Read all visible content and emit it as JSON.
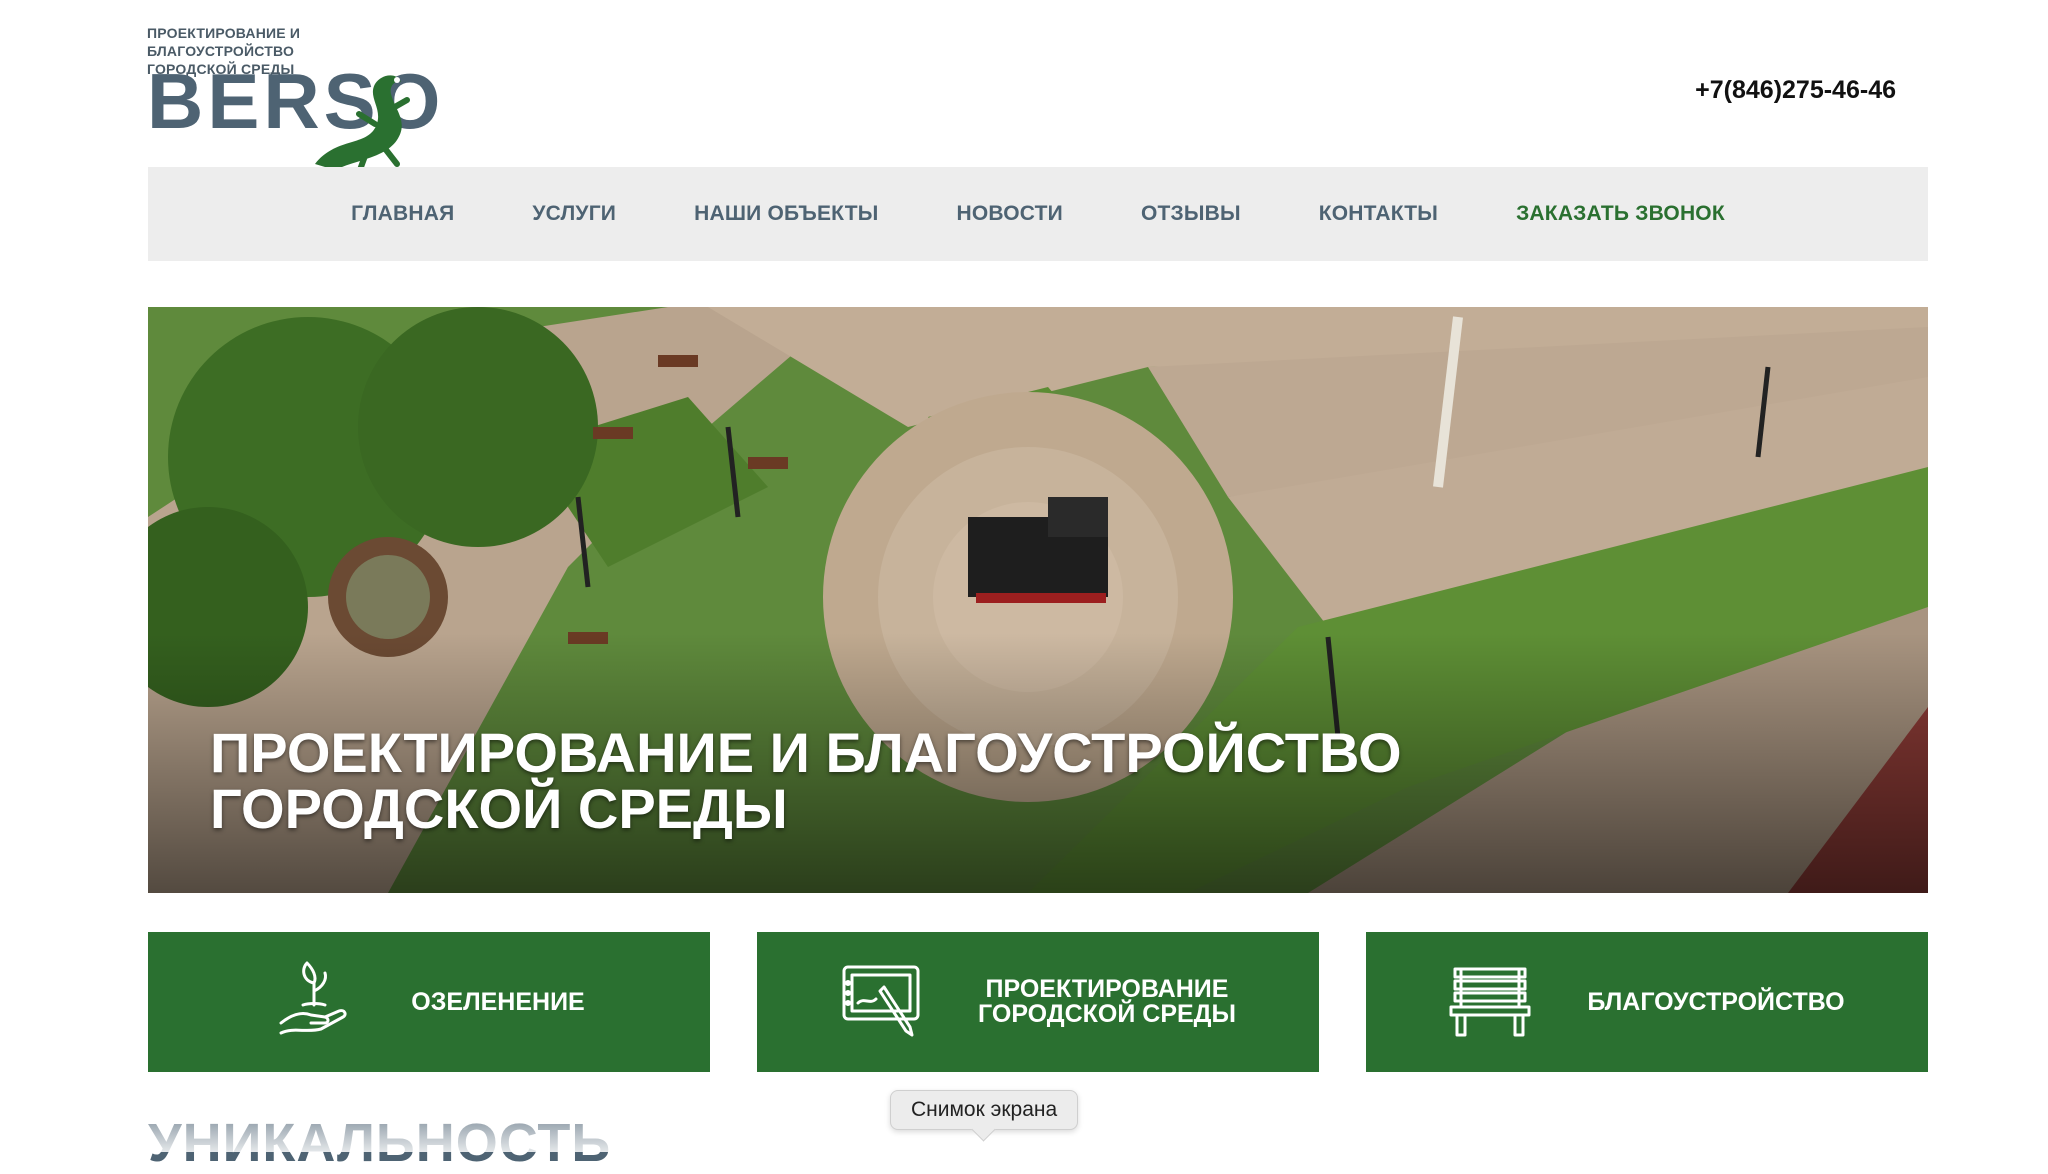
{
  "header": {
    "logo_tagline_1": "Проектирование и благоустройство",
    "logo_tagline_2": "городской среды",
    "logo_word": "BERSO",
    "phone": "+7(846)275-46-46"
  },
  "nav": {
    "items": [
      {
        "label": "Главная"
      },
      {
        "label": "Услуги"
      },
      {
        "label": "Наши объекты"
      },
      {
        "label": "Новости"
      },
      {
        "label": "Отзывы"
      },
      {
        "label": "Контакты"
      },
      {
        "label": "Заказать звонок"
      }
    ]
  },
  "hero": {
    "title_line_1": "Проектирование и благоустройство",
    "title_line_2": "городской среды"
  },
  "cards": [
    {
      "label": "Озеленение",
      "icon": "plant-hand-icon"
    },
    {
      "label": "Проектирование\nгородской среды",
      "icon": "design-tablet-icon"
    },
    {
      "label": "Благоустройство",
      "icon": "bench-icon"
    }
  ],
  "section": {
    "title": "Уникальность"
  },
  "tooltip": {
    "text": "Снимок экрана"
  },
  "colors": {
    "brand_green": "#2a7030",
    "brand_slate": "#4e6373",
    "nav_bg": "#ededed"
  }
}
